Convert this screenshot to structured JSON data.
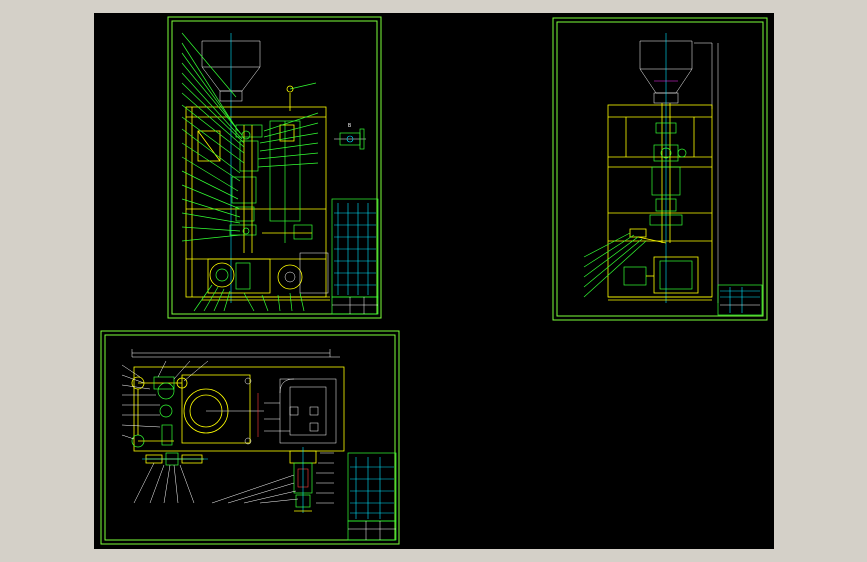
{
  "canvas": {
    "background": "#000000",
    "frame_color": "#7cff3a",
    "line_colors": {
      "yellow": "#ffff00",
      "green": "#33ff33",
      "cyan": "#00e5ff",
      "white": "#ffffff",
      "red": "#ff3b3b",
      "magenta": "#ff33ff"
    }
  },
  "sheets": [
    {
      "id": "front-elevation",
      "view": "front"
    },
    {
      "id": "side-elevation",
      "view": "side"
    },
    {
      "id": "plan-view",
      "view": "top"
    }
  ]
}
